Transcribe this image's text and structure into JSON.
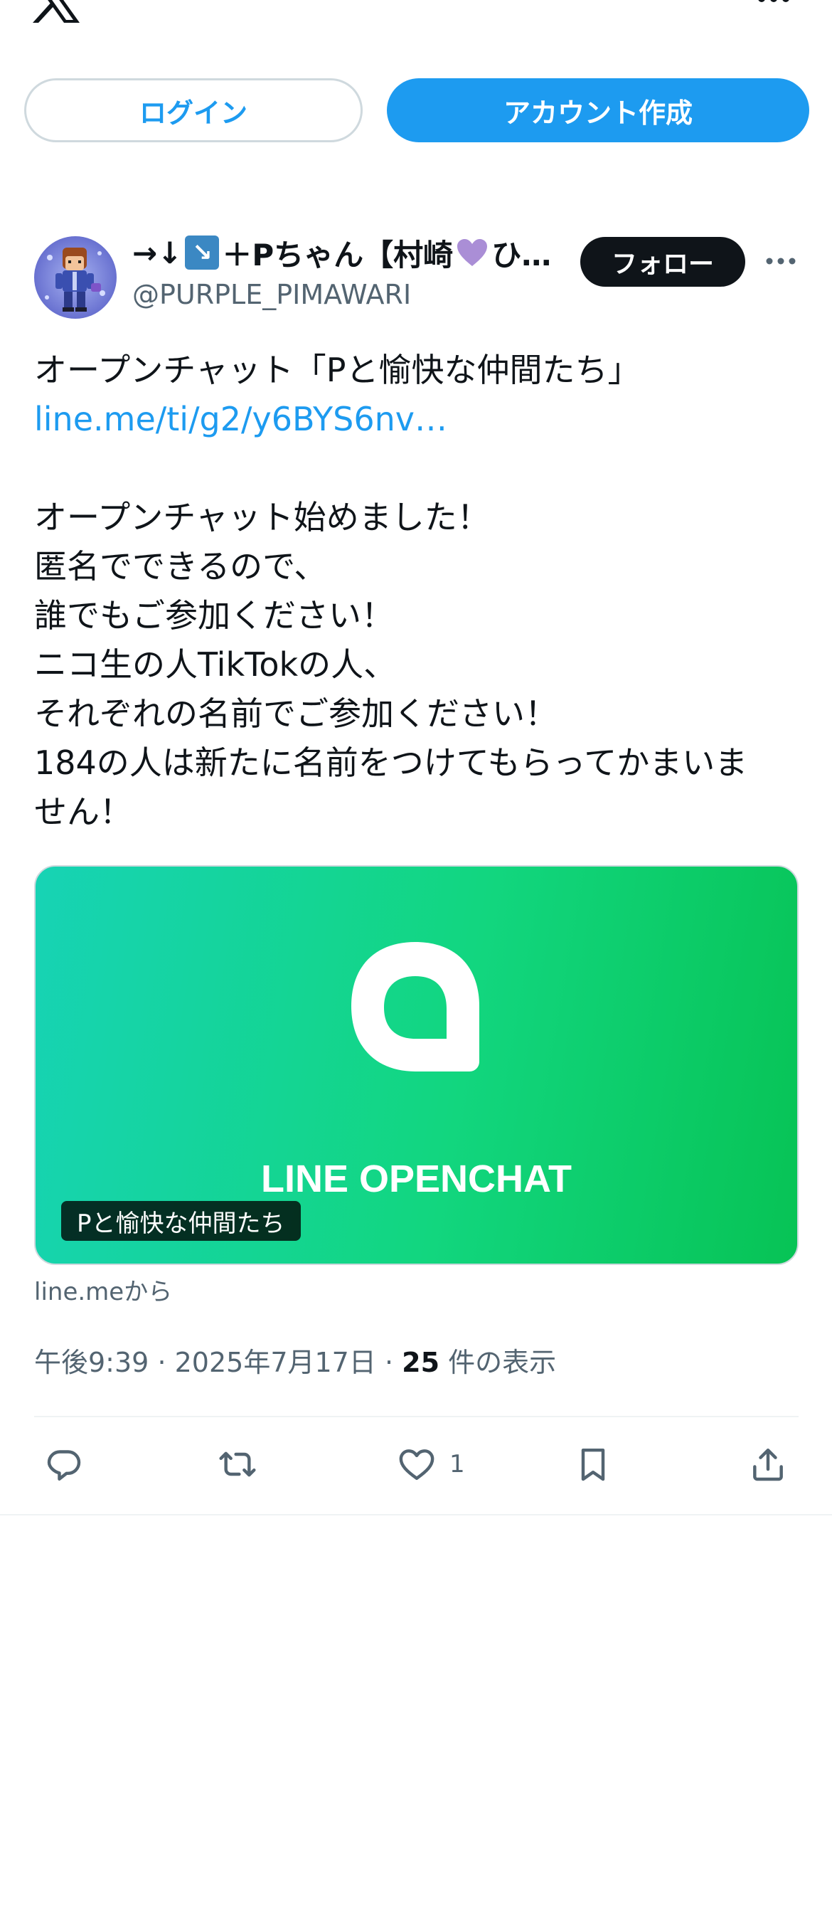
{
  "header": {
    "logo_icon": "x-logo-icon",
    "menu_icon": "more-horizontal-icon",
    "login_label": "ログイン",
    "signup_label": "アカウント作成"
  },
  "post": {
    "author": {
      "display_name_prefix": "→↓",
      "display_name_suffix": "＋Pちゃん【村崎",
      "display_name_tail": "ひ…",
      "handle": "@PURPLE_PIMAWARI"
    },
    "follow_label": "フォロー",
    "text": {
      "line1": "オープンチャット「Pと愉快な仲間たち」",
      "link": "line.me/ti/g2/y6BYS6nv…",
      "line3": "オープンチャット始めました！",
      "line4": "匿名でできるので、",
      "line5": "誰でもご参加ください！",
      "line6": "ニコ生の人TikTokの人、",
      "line7": "それぞれの名前でご参加ください！",
      "line8": "184の人は新たに名前をつけてもらってかまいま",
      "line9": "せん！"
    },
    "card": {
      "wordmark": "LINE OPENCHAT",
      "title": "Pと愉快な仲間たち",
      "source": "line.meから"
    },
    "meta": {
      "time": "午後9:39",
      "date": "2025年7月17日",
      "views": "25",
      "views_label": "件の表示"
    },
    "actions": {
      "like_count": "1"
    }
  },
  "colors": {
    "accent": "#1d9bf0",
    "text": "#0f1419",
    "secondary": "#536471",
    "card_start": "#17d3b5",
    "card_end": "#07c355"
  }
}
